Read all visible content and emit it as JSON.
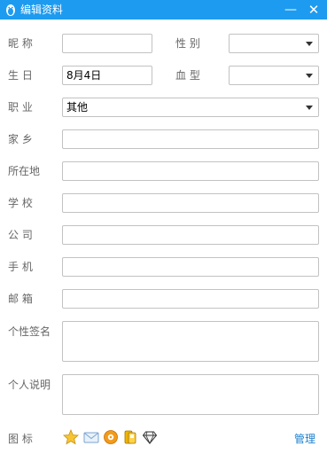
{
  "window": {
    "title": "编辑资料",
    "close_glyph": "✕",
    "minimize_glyph": "—"
  },
  "fields": {
    "nickname": {
      "label": "昵 称",
      "value": ""
    },
    "gender": {
      "label": "性 别",
      "value": ""
    },
    "birthday": {
      "label": "生 日",
      "value": "8月4日"
    },
    "blood_type": {
      "label": "血 型",
      "value": ""
    },
    "occupation": {
      "label": "职 业",
      "value": "其他"
    },
    "hometown": {
      "label": "家 乡",
      "value": ""
    },
    "location": {
      "label": "所在地",
      "value": ""
    },
    "school": {
      "label": "学 校",
      "value": ""
    },
    "company": {
      "label": "公 司",
      "value": ""
    },
    "mobile": {
      "label": "手 机",
      "value": ""
    },
    "email": {
      "label": "邮 箱",
      "value": ""
    },
    "signature": {
      "label": "个性签名",
      "value": ""
    },
    "description": {
      "label": "个人说明",
      "value": ""
    }
  },
  "icons_row": {
    "label": "图 标",
    "manage_label": "管理",
    "badges": [
      "star-badge-icon",
      "mail-badge-icon",
      "music-badge-icon",
      "phone-badge-icon",
      "diamond-badge-icon"
    ]
  },
  "colors": {
    "titlebar": "#1d9bf0",
    "link": "#1a7fcf"
  }
}
